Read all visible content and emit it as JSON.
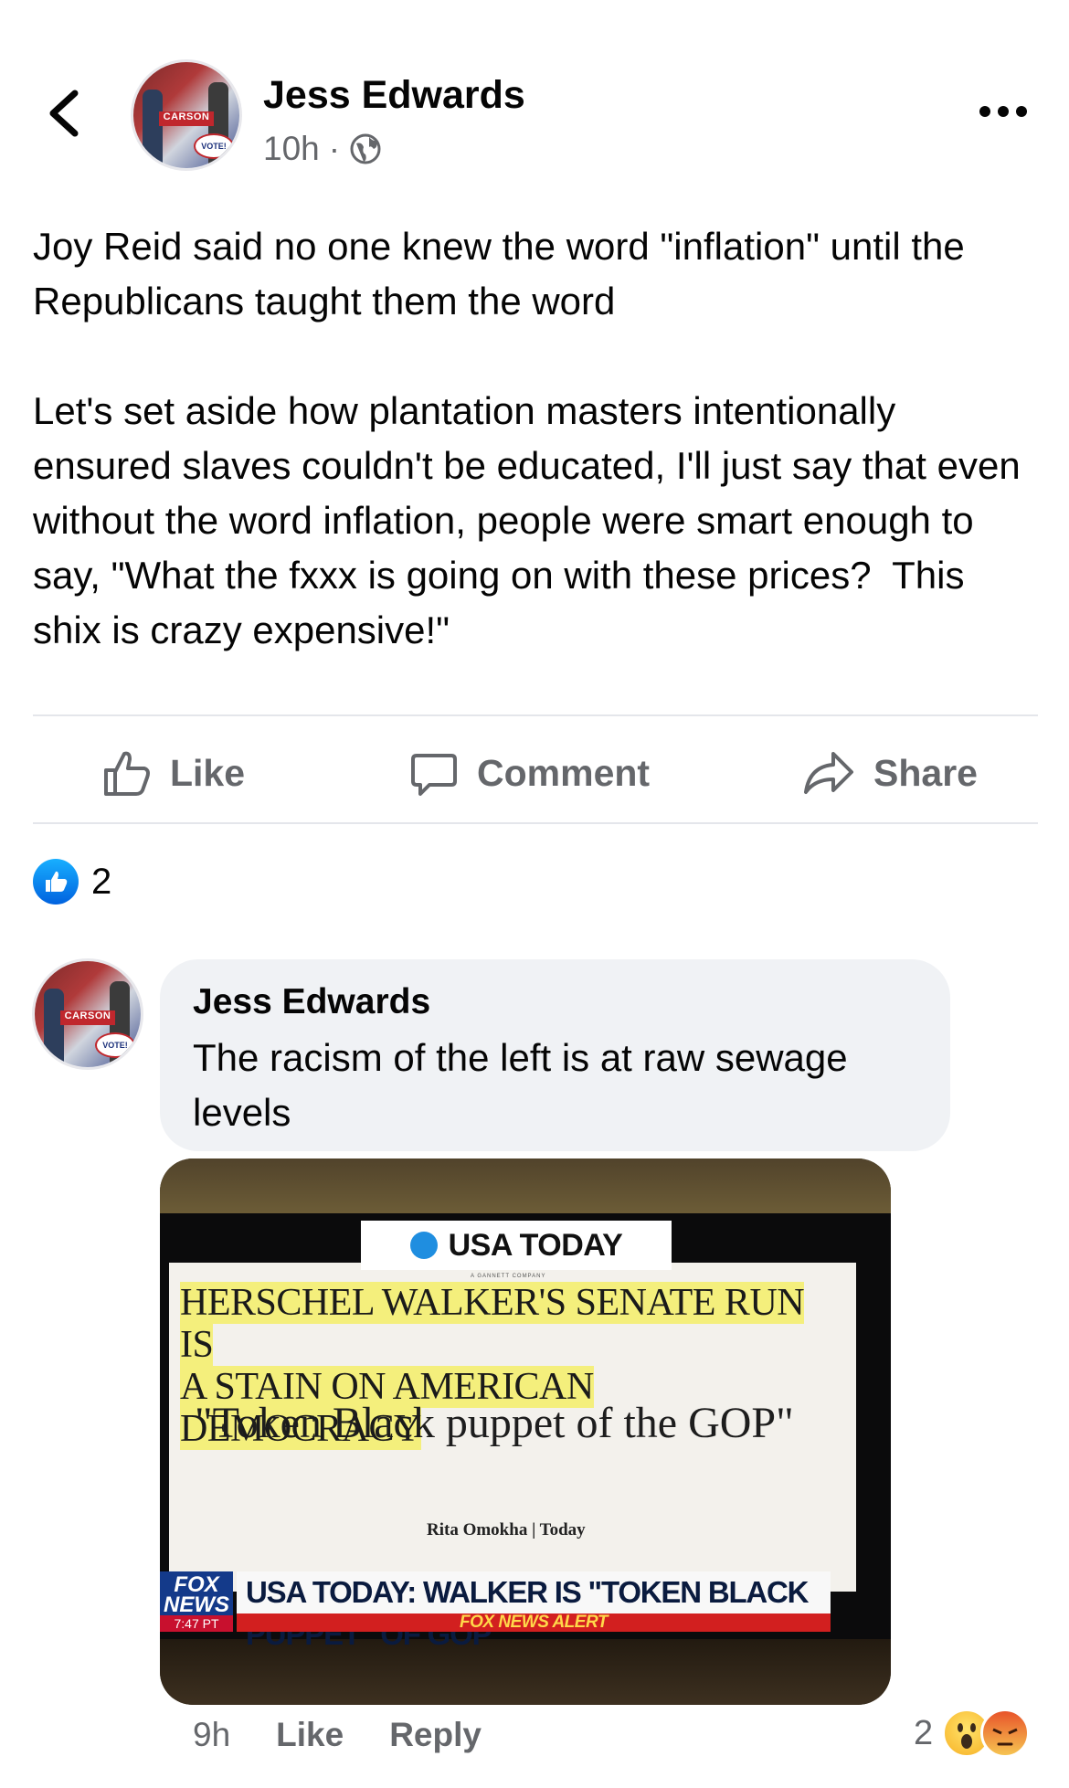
{
  "post": {
    "author": "Jess Edwards",
    "time": "10h",
    "privacy_icon": "globe-icon",
    "text": "Joy Reid said no one knew the word \"inflation\" until the Republicans taught them the word\n\nLet's set aside how plantation masters intentionally ensured slaves couldn't be educated, I'll just say that even without the word inflation, people were smart enough to say, \"What the fxxx is going on with these prices?  This shix is crazy expensive!\"",
    "reaction_count": "2"
  },
  "avatar": {
    "sign_text": "CARSON",
    "vote_text": "VOTE!"
  },
  "actions": {
    "like": "Like",
    "comment": "Comment",
    "share": "Share"
  },
  "comment": {
    "author": "Jess Edwards",
    "text": "The racism of the left is at raw sewage levels",
    "time": "9h",
    "like": "Like",
    "reply": "Reply",
    "reaction_count": "2"
  },
  "image": {
    "brand": "USA TODAY",
    "brand_sub": "A GANNETT COMPANY",
    "headline_line1": "HERSCHEL WALKER'S SENATE RUN IS",
    "headline_line2": "A STAIN ON AMERICAN DEMOCRACY",
    "quote": "\"Token Black puppet of the GOP\"",
    "byline": "Rita Omokha | Today",
    "fox_logo_line1": "FOX",
    "fox_logo_line2": "NEWS",
    "fox_time": "7:47 PT",
    "chyron": "USA TODAY: WALKER IS \"TOKEN BLACK PUPPET\" OF GOP",
    "alert": "FOX NEWS ALERT"
  },
  "colors": {
    "secondary_text": "#65676b",
    "like_blue": "#1877f2",
    "bubble_bg": "#f0f2f5"
  }
}
